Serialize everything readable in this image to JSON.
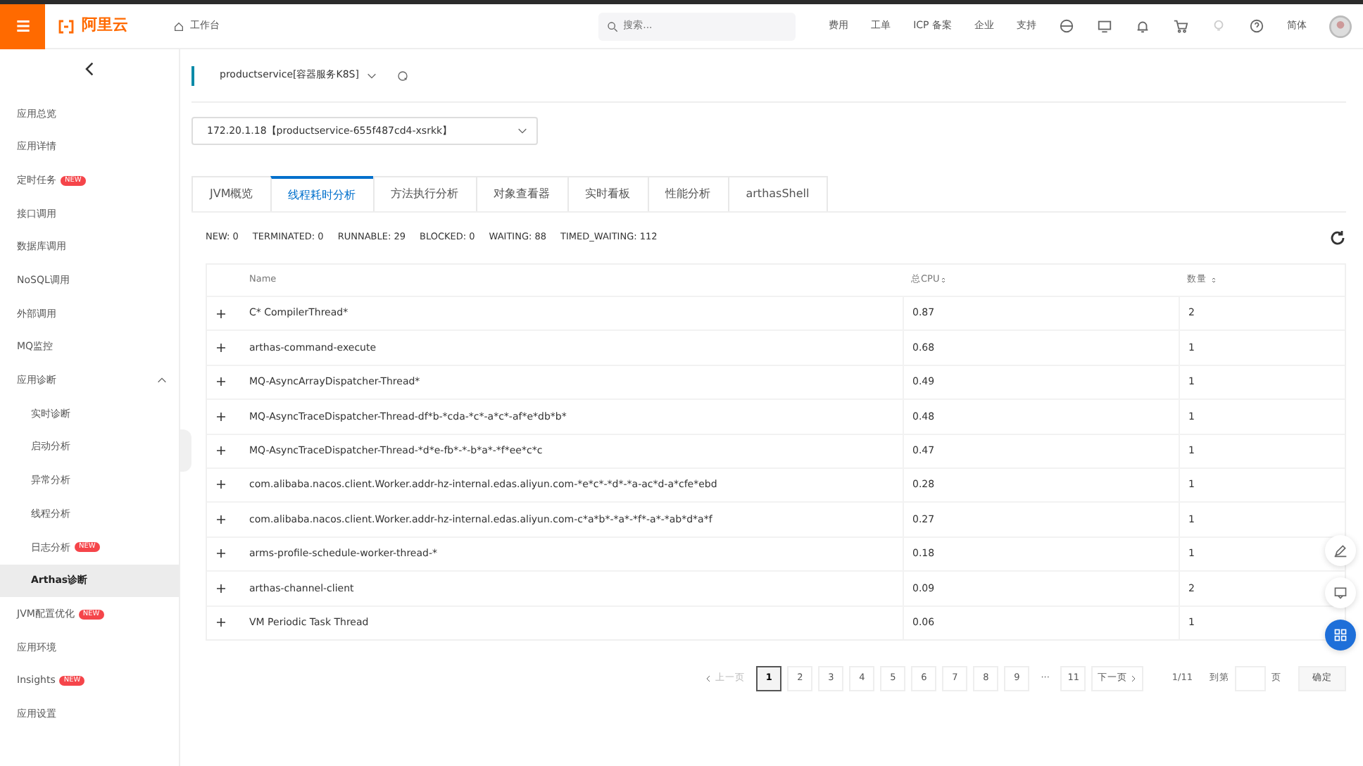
{
  "topbar": {
    "logo": "阿里云",
    "workbench": "工作台",
    "search": {
      "placeholder": "搜索..."
    },
    "links": [
      "费用",
      "工单",
      "ICP 备案",
      "企业",
      "支持"
    ],
    "language": "简体"
  },
  "sidebar": {
    "items": [
      {
        "label": "应用总览",
        "selected": false
      },
      {
        "label": "应用详情",
        "selected": false
      },
      {
        "label": "定时任务",
        "badge": "NEW",
        "selected": false
      },
      {
        "label": "接口调用",
        "selected": false
      },
      {
        "label": "数据库调用",
        "selected": false
      },
      {
        "label": "NoSQL调用",
        "selected": false
      },
      {
        "label": "外部调用",
        "selected": false
      },
      {
        "label": "MQ监控",
        "selected": false
      },
      {
        "label": "应用诊断",
        "selected": false,
        "expanded": true,
        "children": [
          {
            "label": "实时诊断",
            "selected": false
          },
          {
            "label": "启动分析",
            "selected": false
          },
          {
            "label": "异常分析",
            "selected": false
          },
          {
            "label": "线程分析",
            "selected": false
          },
          {
            "label": "日志分析",
            "badge": "NEW",
            "selected": false
          },
          {
            "label": "Arthas诊断",
            "selected": true
          }
        ]
      },
      {
        "label": "JVM配置优化",
        "badge": "NEW",
        "selected": false
      },
      {
        "label": "应用环境",
        "selected": false
      },
      {
        "label": "Insights",
        "badge": "NEW",
        "selected": false
      },
      {
        "label": "应用设置",
        "selected": false
      }
    ]
  },
  "app_selector": {
    "value": "productservice[容器服务K8S]"
  },
  "instance_selector": {
    "value": "172.20.1.18【productservice-655f487cd4-xsrkk】"
  },
  "tabs": [
    {
      "label": "JVM概览",
      "selected": false
    },
    {
      "label": "线程耗时分析",
      "selected": true
    },
    {
      "label": "方法执行分析",
      "selected": false
    },
    {
      "label": "对象查看器",
      "selected": false
    },
    {
      "label": "实时看板",
      "selected": false
    },
    {
      "label": "性能分析",
      "selected": false
    },
    {
      "label": "arthasShell",
      "selected": false
    }
  ],
  "thread_stats": [
    {
      "label": "NEW:",
      "value": "0"
    },
    {
      "label": "TERMINATED:",
      "value": "0"
    },
    {
      "label": "RUNNABLE:",
      "value": "29"
    },
    {
      "label": "BLOCKED:",
      "value": "0"
    },
    {
      "label": "WAITING:",
      "value": "88"
    },
    {
      "label": "TIMED_WAITING:",
      "value": "112"
    }
  ],
  "table": {
    "columns": [
      {
        "label": "Name",
        "sortable": false
      },
      {
        "label": "总CPU",
        "sortable": true
      },
      {
        "label": "数量",
        "sortable": true
      }
    ],
    "rows": [
      [
        "C* CompilerThread*",
        "0.87",
        "2"
      ],
      [
        "arthas-command-execute",
        "0.68",
        "1"
      ],
      [
        "MQ-AsyncArrayDispatcher-Thread*",
        "0.49",
        "1"
      ],
      [
        "MQ-AsyncTraceDispatcher-Thread-df*b-*cda-*c*-a*c*-af*e*db*b*",
        "0.48",
        "1"
      ],
      [
        "MQ-AsyncTraceDispatcher-Thread-*d*e-fb*-*-b*a*-*f*ee*c*c",
        "0.47",
        "1"
      ],
      [
        "com.alibaba.nacos.client.Worker.addr-hz-internal.edas.aliyun.com-*e*c*-*d*-*a-ac*d-a*cfe*ebd",
        "0.28",
        "1"
      ],
      [
        "com.alibaba.nacos.client.Worker.addr-hz-internal.edas.aliyun.com-c*a*b*-*a*-*f*-a*-*ab*d*a*f",
        "0.27",
        "1"
      ],
      [
        "arms-profile-schedule-worker-thread-*",
        "0.18",
        "1"
      ],
      [
        "arthas-channel-client",
        "0.09",
        "2"
      ],
      [
        "VM Periodic Task Thread",
        "0.06",
        "1"
      ]
    ]
  },
  "pagination": {
    "prev": {
      "label": "上一页",
      "disabled": true
    },
    "pages": [
      {
        "label": "1",
        "selected": true
      },
      {
        "label": "2",
        "selected": false
      },
      {
        "label": "3",
        "selected": false
      },
      {
        "label": "4",
        "selected": false
      },
      {
        "label": "5",
        "selected": false
      },
      {
        "label": "6",
        "selected": false
      },
      {
        "label": "7",
        "selected": false
      },
      {
        "label": "8",
        "selected": false
      },
      {
        "label": "9",
        "selected": false
      },
      {
        "label": "···",
        "kind": "ellipsis"
      },
      {
        "label": "11",
        "selected": false
      }
    ],
    "next": {
      "label": "下一页",
      "disabled": false
    },
    "summary": "1/11",
    "goto_label": "到第",
    "page_unit": "页",
    "confirm": "确定"
  }
}
